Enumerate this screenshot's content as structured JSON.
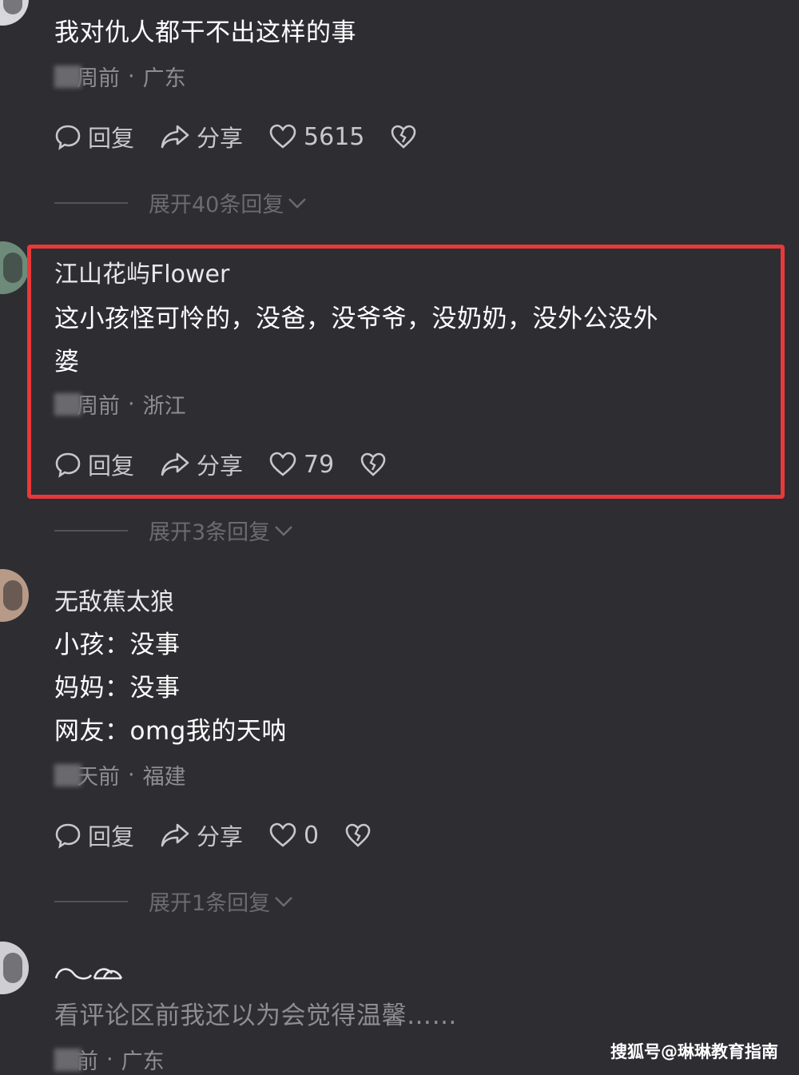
{
  "comments": [
    {
      "text": "我对仇人都干不出这样的事",
      "time_suffix": "周前",
      "location": "广东",
      "reply_label": "回复",
      "share_label": "分享",
      "likes": "5615",
      "expand_label": "展开40条回复"
    },
    {
      "username": "江山花屿Flower",
      "text_line1": "这小孩怪可怜的，没爸，没爷爷，没奶奶，没外公没外",
      "text_line2": "婆",
      "time_suffix": "周前",
      "location": "浙江",
      "reply_label": "回复",
      "share_label": "分享",
      "likes": "79",
      "expand_label": "展开3条回复"
    },
    {
      "username": "无敌蕉太狼",
      "lines": [
        "小孩：没事",
        "妈妈：没事",
        "网友：omg我的天呐"
      ],
      "time_suffix": "天前",
      "location": "福建",
      "reply_label": "回复",
      "share_label": "分享",
      "likes": "0",
      "expand_label": "展开1条回复"
    },
    {
      "text": "看评论区前我还以为会觉得温馨……",
      "time_suffix": "前",
      "location": "广东"
    }
  ],
  "meta_separator": "·",
  "watermark": "搜狐号@琳琳教育指南",
  "colors": {
    "background": "#2e2d32",
    "highlight": "#e8393a"
  }
}
